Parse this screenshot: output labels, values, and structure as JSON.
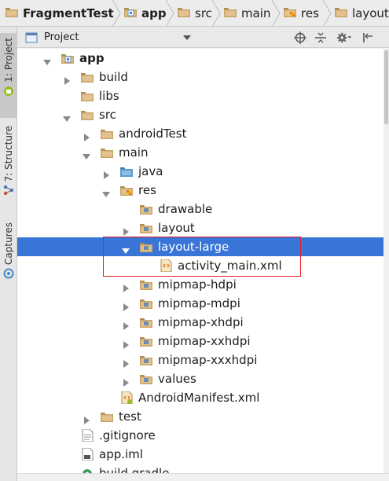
{
  "breadcrumb": {
    "items": [
      {
        "label": "FragmentTest",
        "icon": "project-folder-icon"
      },
      {
        "label": "app",
        "icon": "module-folder-icon"
      },
      {
        "label": "src",
        "icon": "folder-icon"
      },
      {
        "label": "main",
        "icon": "folder-icon"
      },
      {
        "label": "res",
        "icon": "resource-folder-icon"
      },
      {
        "label": "layout-",
        "icon": "folder-icon"
      }
    ]
  },
  "tool_strip": {
    "tabs": [
      {
        "label": "1: Project",
        "icon": "android-icon"
      },
      {
        "label": "7: Structure",
        "icon": "structure-icon"
      },
      {
        "label": "Captures",
        "icon": "captures-icon"
      }
    ]
  },
  "project_header": {
    "title": "Project",
    "icons": [
      "project-view-icon",
      "dropdown-arrow-icon",
      "locate-icon",
      "collapse-all-icon",
      "settings-gear-icon",
      "hide-panel-icon"
    ]
  },
  "tree": [
    {
      "label": "app",
      "depth": 0,
      "expanded": true,
      "icon": "module-folder-icon",
      "bold": true
    },
    {
      "label": "build",
      "depth": 1,
      "expanded": false,
      "icon": "folder-icon"
    },
    {
      "label": "libs",
      "depth": 1,
      "expanded": null,
      "icon": "folder-icon"
    },
    {
      "label": "src",
      "depth": 1,
      "expanded": true,
      "icon": "folder-icon"
    },
    {
      "label": "androidTest",
      "depth": 2,
      "expanded": false,
      "icon": "folder-icon"
    },
    {
      "label": "main",
      "depth": 2,
      "expanded": true,
      "icon": "folder-icon"
    },
    {
      "label": "java",
      "depth": 3,
      "expanded": false,
      "icon": "source-folder-icon"
    },
    {
      "label": "res",
      "depth": 3,
      "expanded": true,
      "icon": "resource-folder-icon"
    },
    {
      "label": "drawable",
      "depth": 4,
      "expanded": null,
      "icon": "package-folder-icon"
    },
    {
      "label": "layout",
      "depth": 4,
      "expanded": false,
      "icon": "package-folder-icon"
    },
    {
      "label": "layout-large",
      "depth": 4,
      "expanded": true,
      "icon": "package-folder-icon",
      "selected": true
    },
    {
      "label": "activity_main.xml",
      "depth": 5,
      "expanded": null,
      "icon": "layout-xml-icon"
    },
    {
      "label": "mipmap-hdpi",
      "depth": 4,
      "expanded": false,
      "icon": "package-folder-icon"
    },
    {
      "label": "mipmap-mdpi",
      "depth": 4,
      "expanded": false,
      "icon": "package-folder-icon"
    },
    {
      "label": "mipmap-xhdpi",
      "depth": 4,
      "expanded": false,
      "icon": "package-folder-icon"
    },
    {
      "label": "mipmap-xxhdpi",
      "depth": 4,
      "expanded": false,
      "icon": "package-folder-icon"
    },
    {
      "label": "mipmap-xxxhdpi",
      "depth": 4,
      "expanded": false,
      "icon": "package-folder-icon"
    },
    {
      "label": "values",
      "depth": 4,
      "expanded": false,
      "icon": "package-folder-icon"
    },
    {
      "label": "AndroidManifest.xml",
      "depth": 3,
      "expanded": null,
      "icon": "manifest-xml-icon"
    },
    {
      "label": "test",
      "depth": 2,
      "expanded": false,
      "icon": "folder-icon"
    },
    {
      "label": ".gitignore",
      "depth": 1,
      "expanded": null,
      "icon": "text-file-icon"
    },
    {
      "label": "app.iml",
      "depth": 1,
      "expanded": null,
      "icon": "iml-file-icon"
    },
    {
      "label": "build.gradle",
      "depth": 1,
      "expanded": null,
      "icon": "gradle-file-icon"
    }
  ],
  "colors": {
    "selection": "#3875d7",
    "highlight_border": "#e02020",
    "folder": "#c8a46a"
  }
}
